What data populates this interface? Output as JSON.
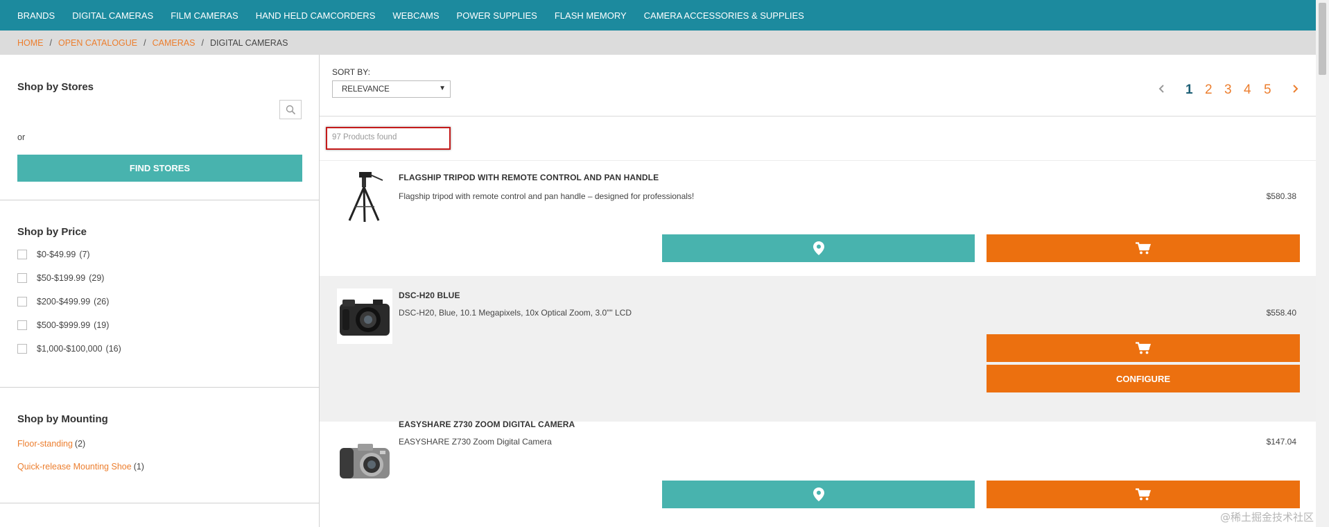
{
  "nav": {
    "items": [
      "BRANDS",
      "DIGITAL CAMERAS",
      "FILM CAMERAS",
      "HAND HELD CAMCORDERS",
      "WEBCAMS",
      "POWER SUPPLIES",
      "FLASH MEMORY",
      "CAMERA ACCESSORIES & SUPPLIES"
    ]
  },
  "breadcrumb": {
    "home": "HOME",
    "catalogue": "OPEN CATALOGUE",
    "cameras": "CAMERAS",
    "current": "DIGITAL CAMERAS",
    "separator": "/"
  },
  "sidebar": {
    "stores": {
      "title": "Shop by Stores",
      "or_text": "or",
      "find_button": "FIND STORES",
      "search_icon": "search-icon"
    },
    "price": {
      "title": "Shop by Price",
      "options": [
        {
          "label": "$0-$49.99",
          "count": "(7)"
        },
        {
          "label": "$50-$199.99",
          "count": "(29)"
        },
        {
          "label": "$200-$499.99",
          "count": "(26)"
        },
        {
          "label": "$500-$999.99",
          "count": "(19)"
        },
        {
          "label": "$1,000-$100,000",
          "count": "(16)"
        }
      ]
    },
    "mounting": {
      "title": "Shop by Mounting",
      "options": [
        {
          "label": "Floor-standing",
          "count": "(2)"
        },
        {
          "label": "Quick-release Mounting Shoe",
          "count": "(1)"
        }
      ]
    }
  },
  "main": {
    "sort_label": "SORT BY:",
    "sort_value": "RELEVANCE",
    "pagination": {
      "prev_icon": "chevron-left-icon",
      "next_icon": "chevron-right-icon",
      "pages": [
        "1",
        "2",
        "3",
        "4",
        "5"
      ],
      "current": "1"
    },
    "products_found": "97 Products found",
    "products": [
      {
        "name": "FLAGSHIP TRIPOD WITH REMOTE CONTROL AND PAN HANDLE",
        "description": "Flagship tripod with remote control and pan handle – designed for professionals!",
        "price": "$580.38",
        "image": "tripod"
      },
      {
        "name": "DSC-H20 BLUE",
        "description": "DSC-H20, Blue, 10.1 Megapixels, 10x Optical Zoom, 3.0\"\" LCD",
        "price": "$558.40",
        "image": "camera-black",
        "configure_label": "CONFIGURE"
      },
      {
        "name": "EASYSHARE Z730 ZOOM DIGITAL CAMERA",
        "description": "EASYSHARE Z730 Zoom Digital Camera",
        "price": "$147.04",
        "image": "camera-silver"
      }
    ]
  },
  "watermark": "@稀土掘金技术社区",
  "colors": {
    "nav_bg": "#1c8a9e",
    "accent_orange": "#ec700f",
    "link_orange": "#ec7e2e",
    "teal_button": "#48b3ae",
    "highlight_border": "#c41a1a"
  }
}
